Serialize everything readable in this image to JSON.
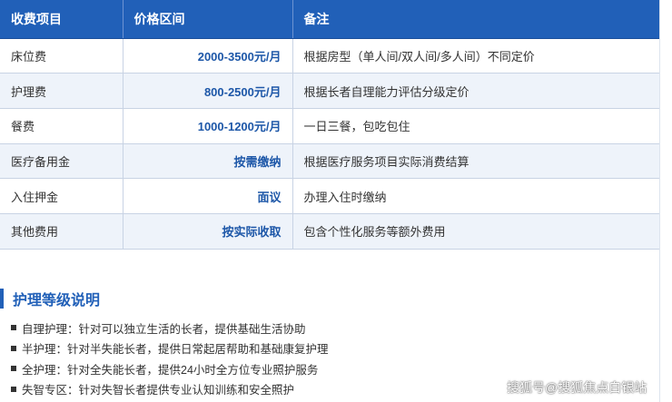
{
  "table": {
    "headers": [
      "收费项目",
      "价格区间",
      "备注"
    ],
    "rows": [
      {
        "item": "床位费",
        "price": "2000-3500元/月",
        "note": "根据房型（单人间/双人间/多人间）不同定价"
      },
      {
        "item": "护理费",
        "price": "800-2500元/月",
        "note": "根据长者自理能力评估分级定价"
      },
      {
        "item": "餐费",
        "price": "1000-1200元/月",
        "note": "一日三餐，包吃包住"
      },
      {
        "item": "医疗备用金",
        "price": "按需缴纳",
        "note": "根据医疗服务项目实际消费结算"
      },
      {
        "item": "入住押金",
        "price": "面议",
        "note": "办理入住时缴纳"
      },
      {
        "item": "其他费用",
        "price": "按实际收取",
        "note": "包含个性化服务等额外费用"
      }
    ]
  },
  "section": {
    "title": "护理等级说明",
    "items": [
      "自理护理：针对可以独立生活的长者，提供基础生活协助",
      "半护理：针对半失能长者，提供日常起居帮助和基础康复护理",
      "全护理：针对全失能长者，提供24小时全方位专业照护服务",
      "失智专区：针对失智长者提供专业认知训练和安全照护"
    ]
  },
  "watermark": "搜狐号@搜狐焦点白银站",
  "colors": {
    "header_bg": "#2160b8",
    "price_text": "#1d57a8",
    "alt_row": "#eef3fa"
  }
}
